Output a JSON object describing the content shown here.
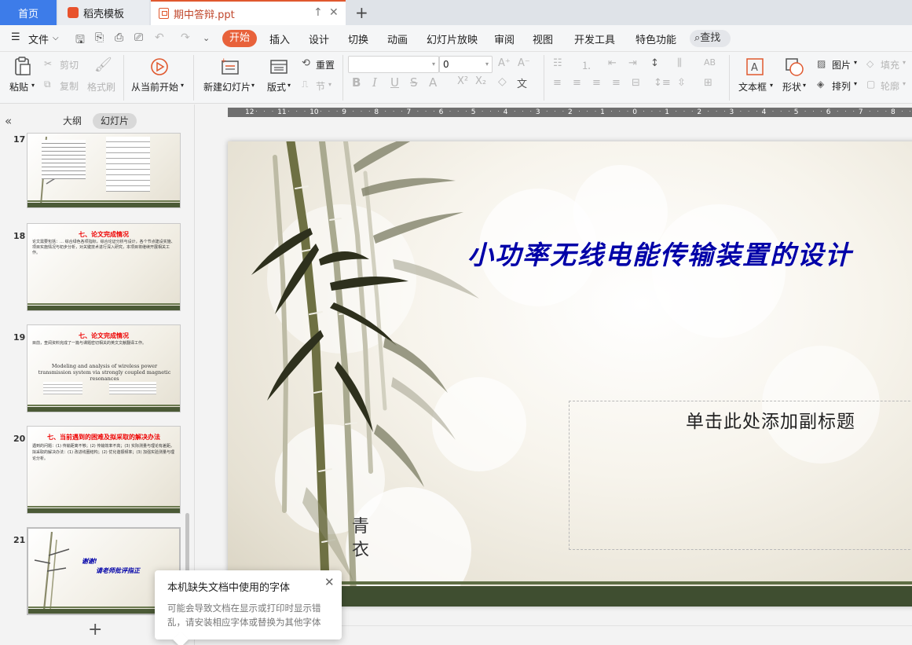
{
  "tabs": {
    "home": "首页",
    "template": "稻壳模板",
    "document": "期中答辩.ppt"
  },
  "menu": {
    "file": "文件",
    "items": [
      "开始",
      "插入",
      "设计",
      "切换",
      "动画",
      "幻灯片放映",
      "审阅",
      "视图",
      "开发工具",
      "特色功能"
    ],
    "search": "查找"
  },
  "ribbon": {
    "paste": "粘贴",
    "cut": "剪切",
    "copy": "复制",
    "format_painter": "格式刷",
    "from_current": "从当前开始",
    "new_slide": "新建幻灯片",
    "layout": "版式",
    "reset": "重置",
    "section": "节",
    "font_size": "0",
    "text_box": "文本框",
    "shape": "形状",
    "picture": "图片",
    "fill": "填充",
    "arrange": "排列",
    "outline": "轮廓"
  },
  "panel": {
    "outline_tab": "大纲",
    "slides_tab": "幻灯片"
  },
  "thumbs": [
    {
      "num": "17"
    },
    {
      "num": "18",
      "title": "七、论文完成情况",
      "body": "论文需要包括：…  综合绿色各项指标，综合论证分析与设计，各个节点建设实施、项目实施情况与初步分析，对关键技术进行深入研究，本项目将继续开展相关工作。"
    },
    {
      "num": "19",
      "title": "七、论文完成情况",
      "body": "目前，查阅资料完成了一篇与课题密切相关的英文文献翻译工作。",
      "en_title": "Modeling and analysis of wireless power transmission system via strongly coupled magnetic resonances"
    },
    {
      "num": "20",
      "title": "七、当前遇到的困难及拟采取的解决办法",
      "body": "遇到的问题：(1) 传输距离不够；(2) 传输效率不高；(3) 实际测量与理论有差距。拟采取的解决办法：(1) 改进线圈结构；(2) 优化谐振频率；(3) 加强实验测量与理论分析。"
    },
    {
      "num": "21",
      "line1": "谢谢!",
      "line2": "请老师批评指正"
    }
  ],
  "ruler": [
    "12",
    "11",
    "10",
    "9",
    "8",
    "7",
    "6",
    "5",
    "4",
    "3",
    "2",
    "1",
    "0",
    "1",
    "2",
    "3",
    "4",
    "5",
    "6",
    "7",
    "8"
  ],
  "slide": {
    "title": "小功率无线电能传输装置的设计",
    "subtitle_placeholder": "单击此处添加副标题",
    "signature": "青衣"
  },
  "popup": {
    "title": "本机缺失文档中使用的字体",
    "body": "可能会导致文档在显示或打印时显示错乱，请安装相应字体或替换为其他字体"
  }
}
